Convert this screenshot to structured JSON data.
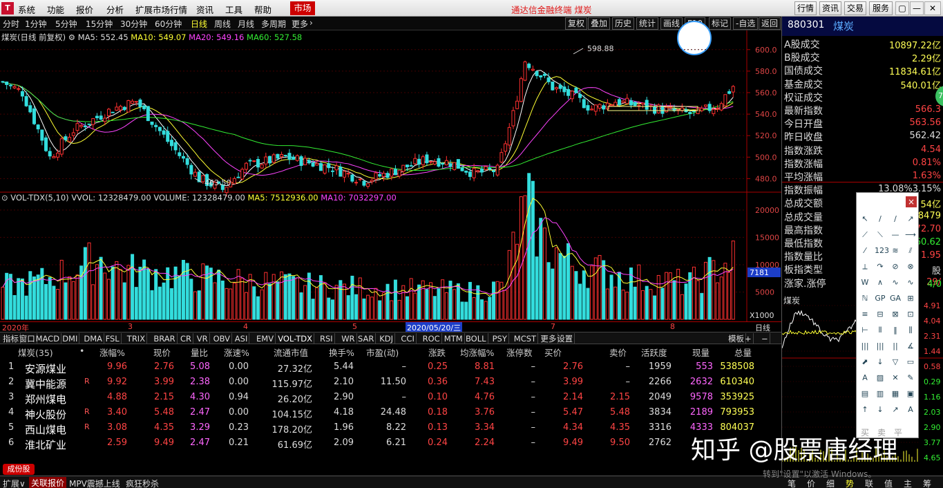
{
  "app": {
    "title": "通达信金融终端  煤炭",
    "logo": "T",
    "market_btn": "市场"
  },
  "menu": [
    "系统",
    "功能",
    "报价",
    "分析",
    "扩展市场行情",
    "资讯",
    "工具",
    "帮助"
  ],
  "top_right": [
    "行情",
    "资讯",
    "交易",
    "服务"
  ],
  "window_controls": [
    "▢",
    "—",
    "▭",
    "✕"
  ],
  "periods": [
    "分时",
    "1分钟",
    "5分钟",
    "15分钟",
    "30分钟",
    "60分钟",
    "日线",
    "周线",
    "月线",
    "多周期",
    "更多"
  ],
  "toolbar": [
    "复权",
    "叠加",
    "历史",
    "统计",
    "画线",
    "F10",
    "标记",
    "-自选",
    "返回"
  ],
  "ma": {
    "name": "煤炭(日线 前复权)",
    "ma5": "MA5: 552.45",
    "ma10": "MA10: 549.07",
    "ma20": "MA20: 549.16",
    "ma60": "MA60: 527.58"
  },
  "vol": {
    "name": "VOL-TDX(5,10)",
    "vvol": "VVOL: 12328479.00",
    "volume": "VOLUME: 12328479.00",
    "ma5": "MA5: 7512936.00",
    "ma10": "MA10: 7032297.00"
  },
  "price_axis": [
    "600.0",
    "580.0",
    "560.0",
    "540.0",
    "520.0",
    "500.0",
    "480.0"
  ],
  "vol_axis": [
    "20000",
    "15000",
    "10000",
    "5000",
    "X1000"
  ],
  "vol_current": "7181",
  "annotations": {
    "high": "598.88",
    "low": "463.50"
  },
  "dates": [
    "2020年",
    "3",
    "4",
    "5",
    "2020/05/20/三",
    "7",
    "8",
    "日线"
  ],
  "indicators": [
    "指标",
    "窗口",
    "MACD",
    "DMI",
    "DMA",
    "FSL",
    "TRIX",
    "BRAR",
    "CR",
    "VR",
    "OBV",
    "ASI",
    "EMV",
    "VOL-TDX",
    "RSI",
    "WR",
    "SAR",
    "KDJ",
    "CCI",
    "ROC",
    "MTM",
    "BOLL",
    "PSY",
    "MCST",
    "更多",
    "设置"
  ],
  "ind_right": [
    "模板",
    "+",
    "−"
  ],
  "table": {
    "headers": [
      "煤炭(35)",
      "•",
      "涨幅%",
      "现价",
      "量比",
      "涨速%",
      "流通市值",
      "换手%",
      "市盈(动)",
      "涨跌",
      "均涨幅%",
      "涨停数",
      "买价",
      "卖价",
      "活跃度",
      "现量",
      "总量"
    ],
    "rows": [
      [
        "1",
        "安源煤业",
        "",
        "9.96",
        "2.76",
        "5.08",
        "0.00",
        "27.32亿",
        "5.44",
        "–",
        "0.25",
        "8.81",
        "–",
        "2.76",
        "–",
        "1959",
        "553",
        "538508"
      ],
      [
        "2",
        "冀中能源",
        "R",
        "9.92",
        "3.99",
        "2.38",
        "0.00",
        "115.97亿",
        "2.10",
        "11.50",
        "0.36",
        "7.43",
        "–",
        "3.99",
        "–",
        "2266",
        "2632",
        "610340"
      ],
      [
        "3",
        "郑州煤电",
        "",
        "4.88",
        "2.15",
        "4.30",
        "0.94",
        "26.20亿",
        "2.90",
        "–",
        "0.10",
        "4.76",
        "–",
        "2.14",
        "2.15",
        "2049",
        "9578",
        "353925"
      ],
      [
        "4",
        "神火股份",
        "R",
        "3.40",
        "5.48",
        "2.47",
        "0.00",
        "104.15亿",
        "4.18",
        "24.48",
        "0.18",
        "3.76",
        "–",
        "5.47",
        "5.48",
        "3834",
        "2189",
        "793953"
      ],
      [
        "5",
        "西山煤电",
        "R",
        "3.08",
        "4.35",
        "3.29",
        "0.23",
        "178.20亿",
        "1.96",
        "8.22",
        "0.13",
        "3.34",
        "–",
        "4.34",
        "4.35",
        "3316",
        "4333",
        "804037"
      ],
      [
        "6",
        "淮北矿业",
        "",
        "2.59",
        "9.49",
        "2.47",
        "0.21",
        "61.69亿",
        "2.09",
        "6.21",
        "0.24",
        "2.24",
        "–",
        "9.49",
        "9.50",
        "2762",
        "",
        ""
      ]
    ]
  },
  "index": {
    "code": "880301",
    "name": "煤炭",
    "fields": [
      [
        "A股成交",
        "10897.22亿",
        "#ffff55"
      ],
      [
        "B股成交",
        "2.29亿",
        "#ffff55"
      ],
      [
        "国债成交",
        "11834.61亿",
        "#ffff55"
      ],
      [
        "基金成交",
        "540.01亿",
        "#ffff55"
      ],
      [
        "权证成交",
        "",
        "#ffff55"
      ],
      [
        "最新指数",
        "566.3",
        "#ff4444"
      ],
      [
        "今日开盘",
        "563.56",
        "#ff4444"
      ],
      [
        "昨日收盘",
        "562.42",
        "#dddddd"
      ],
      [
        "指数涨跌",
        "4.54",
        "#ff4444"
      ],
      [
        "指数涨幅",
        "0.81%",
        "#ff4444"
      ],
      [
        "平均涨幅",
        "1.63%",
        "#ff4444"
      ],
      [
        "指数振幅",
        "13.08%3.15%",
        "#dddddd"
      ],
      [
        "总成交额",
        "54亿",
        "#ffff55"
      ],
      [
        "总成交量",
        "8479",
        "#ffff55"
      ],
      [
        "最高指数",
        "72.70",
        "#ff4444"
      ],
      [
        "最低指数",
        "60.62",
        "#33ee33"
      ],
      [
        "指数量比",
        "1.95",
        "#ff4444"
      ],
      [
        "板指类型",
        "股",
        "#dddddd"
      ],
      [
        "涨家.涨停",
        "29/",
        "#ff4444"
      ]
    ],
    "mini_label": "煤炭",
    "extra_right": "4/0",
    "mini_axis": [
      "4.91",
      "4.04",
      "2.31",
      "1.44",
      "0.58",
      "0.29",
      "1.16",
      "2.03",
      "2.90",
      "3.77",
      "4.65"
    ],
    "badge": "75"
  },
  "draw_tools": {
    "close": "×",
    "items": [
      "↖",
      "/",
      "∕",
      "↗",
      "⟋",
      "⟍",
      "—",
      "⟶",
      "⁄",
      "123",
      "≋",
      "⫽",
      "⟂",
      "↷",
      "⊘",
      "⊗",
      "W",
      "∧",
      "∿",
      "∿",
      "ℕ",
      "GP",
      "GA",
      "⊞",
      "≡",
      "⊟",
      "⊠",
      "⊡",
      "⊢",
      "⫴",
      "‖",
      "⫼",
      "|||",
      "|||",
      "||",
      "∡",
      "⬈",
      "↓",
      "▽",
      "▭",
      "A",
      "▨",
      "✕",
      "✎",
      "▤",
      "▥",
      "▦",
      "▣",
      "↑",
      "↓",
      "↗",
      "A"
    ],
    "buy": "买",
    "sell": "卖",
    "flat": "平"
  },
  "status": {
    "left": "扩展∨",
    "tab1": "关联报价",
    "tab2": "MPV震撼上线",
    "tab3": "疯狂秒杀",
    "tabs_right": [
      "笔",
      "价",
      "细",
      "势",
      "联",
      "值",
      "主",
      "筹"
    ],
    "activate": "转到\"设置\"以激活 Windows。",
    "promo": "成份股"
  },
  "watermark": "知乎 @股票唐经理"
}
